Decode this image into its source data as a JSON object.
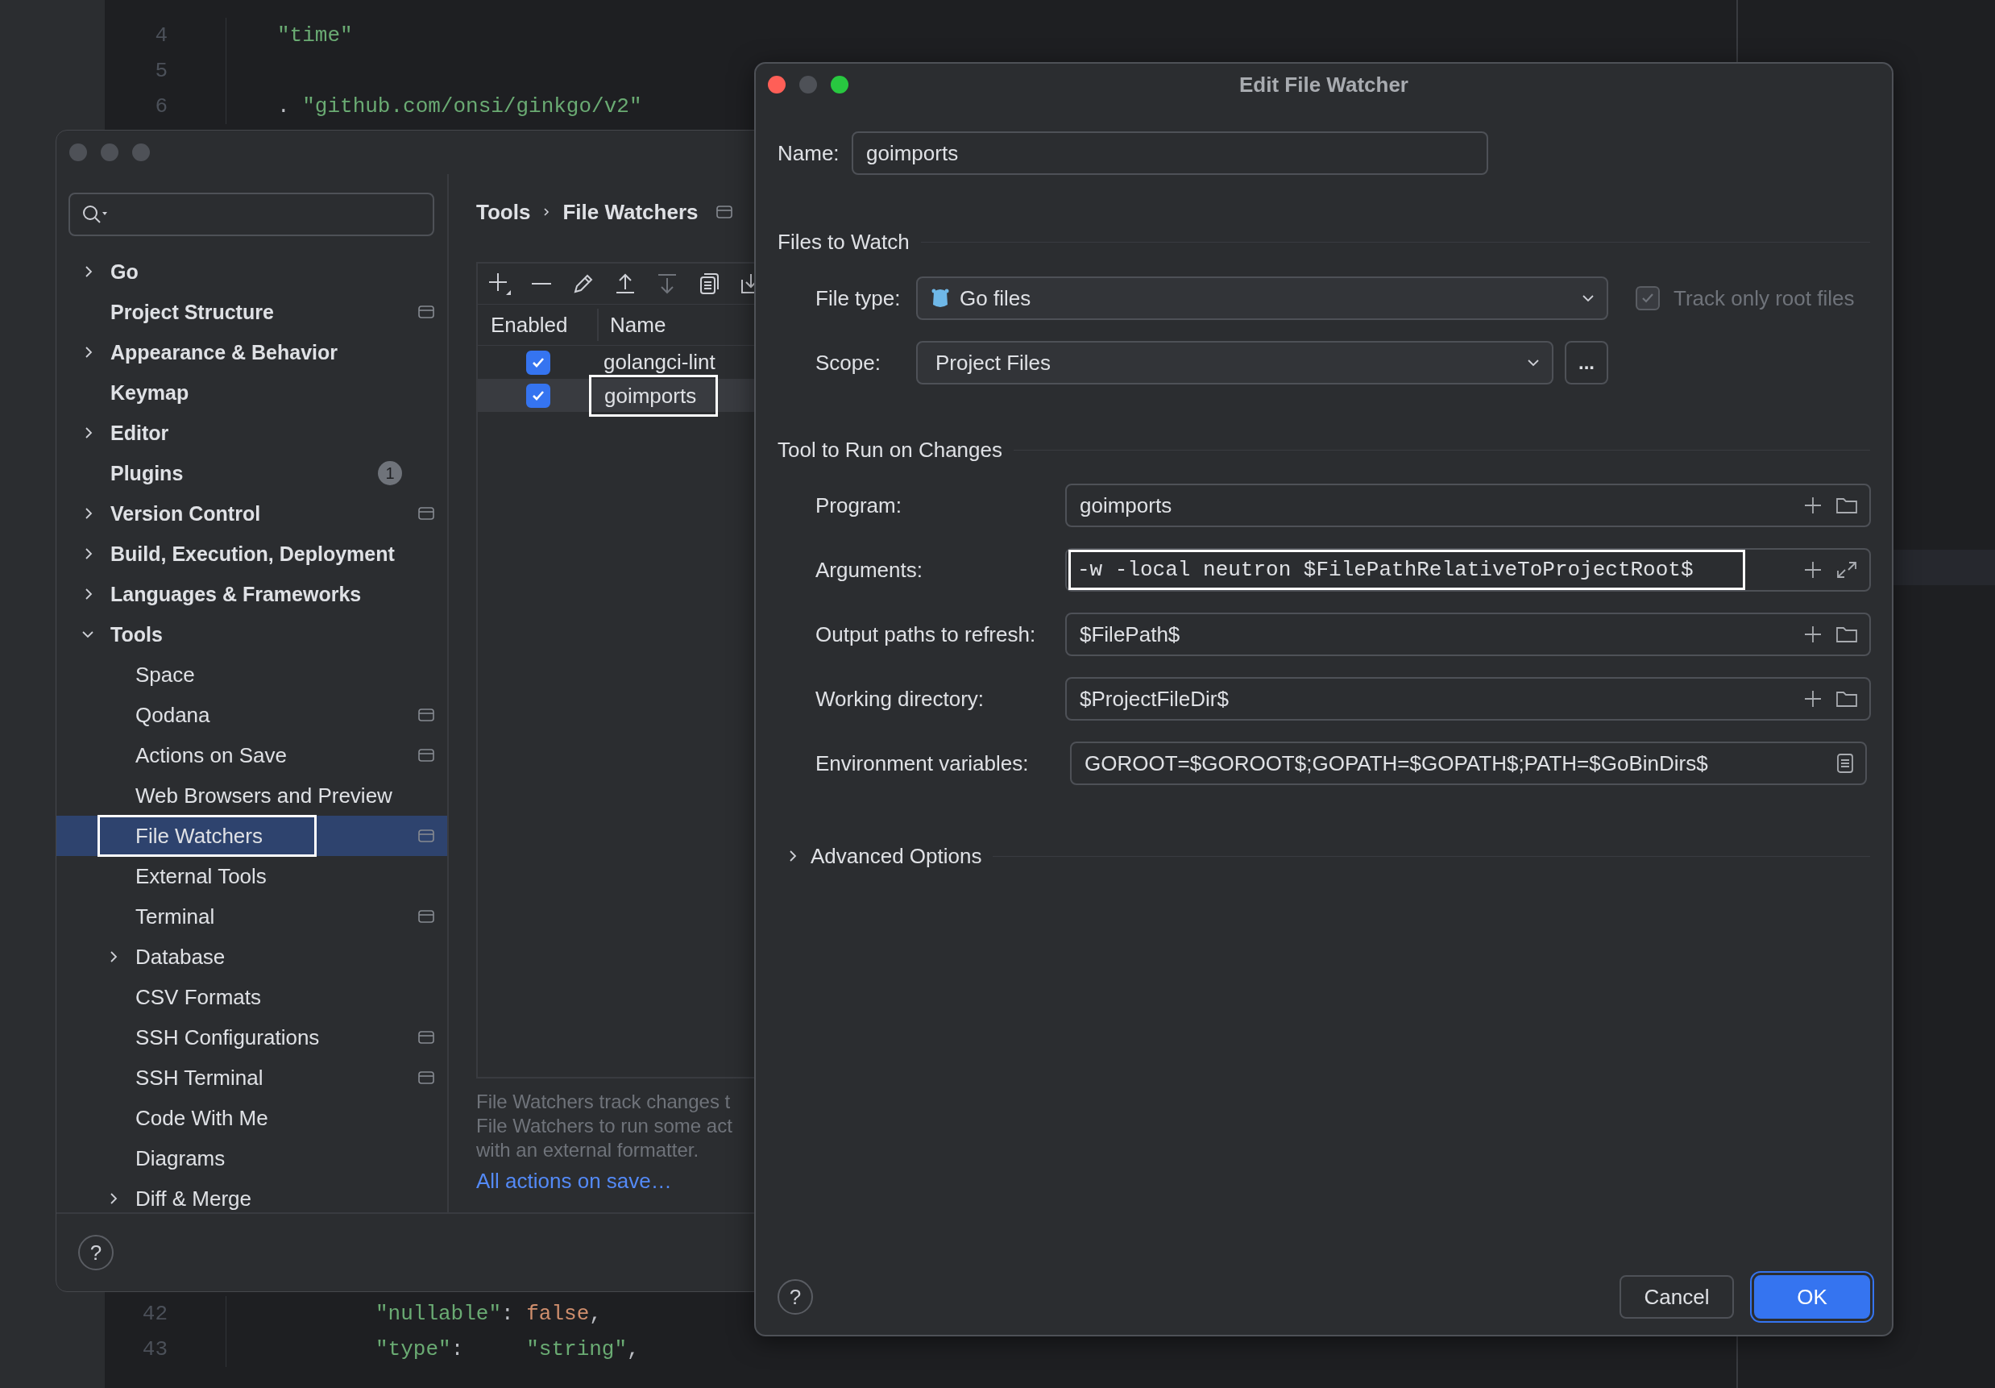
{
  "editor": {
    "top_lines": [
      {
        "number": "4",
        "tokens": [
          {
            "text": "\"time\"",
            "kind": "string"
          }
        ]
      },
      {
        "number": "5"
      },
      {
        "number": "6",
        "tokens": [
          {
            "text": ". ",
            "kind": "plain"
          },
          {
            "text": "\"github.com/onsi/ginkgo/v2\"",
            "kind": "string"
          }
        ]
      }
    ],
    "bottom_lines": [
      {
        "number": "42",
        "tokens": [
          {
            "text": "\"nullable\"",
            "kind": "string"
          },
          {
            "text": ": ",
            "kind": "plain"
          },
          {
            "text": "false",
            "kind": "keyword"
          },
          {
            "text": ",",
            "kind": "plain"
          }
        ]
      },
      {
        "number": "43",
        "tokens": [
          {
            "text": "\"type\"",
            "kind": "string"
          },
          {
            "text": ":     ",
            "kind": "plain"
          },
          {
            "text": "\"string\"",
            "kind": "string"
          },
          {
            "text": ",",
            "kind": "plain"
          }
        ]
      }
    ]
  },
  "settings": {
    "breadcrumb": [
      "Tools",
      "File Watchers"
    ],
    "sidebar": {
      "items": [
        {
          "label": "Go",
          "kind": "group",
          "expanded": false,
          "selected": false
        },
        {
          "label": "Project Structure",
          "kind": "leaf",
          "project_icon": true,
          "selected": false
        },
        {
          "label": "Appearance & Behavior",
          "kind": "group",
          "expanded": false,
          "selected": false
        },
        {
          "label": "Keymap",
          "kind": "leaf",
          "selected": false
        },
        {
          "label": "Editor",
          "kind": "group",
          "expanded": false,
          "selected": false
        },
        {
          "label": "Plugins",
          "kind": "leaf",
          "badge": "1",
          "selected": false
        },
        {
          "label": "Version Control",
          "kind": "group",
          "expanded": false,
          "project_icon": true,
          "selected": false
        },
        {
          "label": "Build, Execution, Deployment",
          "kind": "group",
          "expanded": false,
          "selected": false
        },
        {
          "label": "Languages & Frameworks",
          "kind": "group",
          "expanded": false,
          "selected": false
        },
        {
          "label": "Tools",
          "kind": "group",
          "expanded": true,
          "selected": false,
          "children": [
            {
              "label": "Space",
              "kind": "leaf",
              "selected": false
            },
            {
              "label": "Qodana",
              "kind": "leaf",
              "project_icon": true,
              "selected": false
            },
            {
              "label": "Actions on Save",
              "kind": "leaf",
              "project_icon": true,
              "selected": false
            },
            {
              "label": "Web Browsers and Preview",
              "kind": "leaf",
              "selected": false
            },
            {
              "label": "File Watchers",
              "kind": "leaf",
              "project_icon": true,
              "selected": true,
              "highlighted": true
            },
            {
              "label": "External Tools",
              "kind": "leaf",
              "selected": false
            },
            {
              "label": "Terminal",
              "kind": "leaf",
              "project_icon": true,
              "selected": false
            },
            {
              "label": "Database",
              "kind": "group",
              "expanded": false,
              "selected": false
            },
            {
              "label": "CSV Formats",
              "kind": "leaf",
              "selected": false
            },
            {
              "label": "SSH Configurations",
              "kind": "leaf",
              "project_icon": true,
              "selected": false
            },
            {
              "label": "SSH Terminal",
              "kind": "leaf",
              "project_icon": true,
              "selected": false
            },
            {
              "label": "Code With Me",
              "kind": "leaf",
              "selected": false
            },
            {
              "label": "Diagrams",
              "kind": "leaf",
              "selected": false
            },
            {
              "label": "Diff & Merge",
              "kind": "group",
              "expanded": false,
              "selected": false
            }
          ]
        }
      ]
    },
    "table": {
      "columns": [
        "Enabled",
        "Name"
      ],
      "rows": [
        {
          "enabled": true,
          "name": "golangci-lint",
          "selected": false,
          "highlighted": false
        },
        {
          "enabled": true,
          "name": "goimports",
          "selected": true,
          "highlighted": true
        }
      ]
    },
    "description": [
      "File Watchers track changes t",
      "File Watchers to run some act",
      "with an external formatter."
    ],
    "link": "All actions on save…",
    "help_button": "?"
  },
  "dialog": {
    "title": "Edit File Watcher",
    "name": {
      "label": "Name:",
      "value": "goimports"
    },
    "files_to_watch": {
      "title": "Files to Watch",
      "file_type": {
        "label": "File type:",
        "value": "Go files"
      },
      "track_only_root": {
        "label": "Track only root files",
        "checked": true,
        "disabled": true
      },
      "scope": {
        "label": "Scope:",
        "value": "Project Files",
        "browse_button": "..."
      }
    },
    "tool": {
      "title": "Tool to Run on Changes",
      "fields": [
        {
          "label": "Program:",
          "value": "goimports",
          "kind": "path",
          "highlighted": false
        },
        {
          "label": "Arguments:",
          "value": "-w -local neutron $FilePathRelativeToProjectRoot$",
          "kind": "args",
          "highlighted": true
        },
        {
          "label": "Output paths to refresh:",
          "value": "$FilePath$",
          "kind": "path",
          "highlighted": false
        },
        {
          "label": "Working directory:",
          "value": "$ProjectFileDir$",
          "kind": "path",
          "highlighted": false
        },
        {
          "label": "Environment variables:",
          "value": "GOROOT=$GOROOT$;GOPATH=$GOPATH$;PATH=$GoBinDirs$",
          "kind": "env",
          "highlighted": false
        }
      ]
    },
    "advanced": {
      "label": "Advanced Options",
      "expanded": false
    },
    "help_button": "?",
    "buttons": [
      {
        "label": "Cancel",
        "kind": "secondary"
      },
      {
        "label": "OK",
        "kind": "primary"
      }
    ]
  }
}
